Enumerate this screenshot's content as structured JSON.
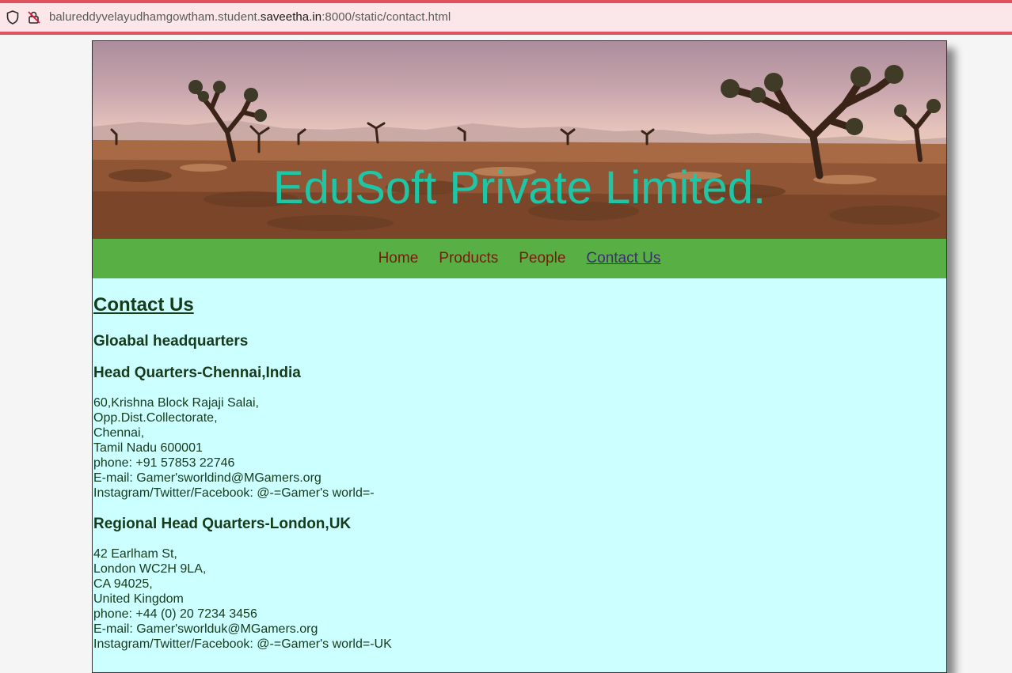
{
  "browser": {
    "url_prefix": "balureddyvelayudhamgowtham.student.",
    "url_domain": "saveetha.in",
    "url_suffix": ":8000/static/contact.html"
  },
  "banner": {
    "title": "EduSoft Private Limited."
  },
  "nav": {
    "items": [
      {
        "label": "Home",
        "active": false
      },
      {
        "label": "Products",
        "active": false
      },
      {
        "label": "People",
        "active": false
      },
      {
        "label": "Contact Us",
        "active": true
      }
    ]
  },
  "content": {
    "heading": "Contact Us",
    "global_heading": "Gloabal headquarters",
    "offices": [
      {
        "title": "Head Quarters-Chennai,India",
        "lines": [
          "60,Krishna Block Rajaji Salai,",
          "Opp.Dist.Collectorate,",
          "Chennai,",
          "Tamil Nadu 600001",
          "phone: +91 57853 22746",
          "E-mail: Gamer'sworldind@MGamers.org",
          "Instagram/Twitter/Facebook: @-=Gamer's world=-"
        ]
      },
      {
        "title": "Regional Head Quarters-London,UK",
        "lines": [
          "42 Earlham St,",
          "London WC2H 9LA,",
          "CA 94025,",
          "United Kingdom",
          "phone: +44 (0) 20 7234 3456",
          "E-mail: Gamer'sworlduk@MGamers.org",
          "Instagram/Twitter/Facebook: @-=Gamer's world=-UK"
        ]
      }
    ]
  }
}
